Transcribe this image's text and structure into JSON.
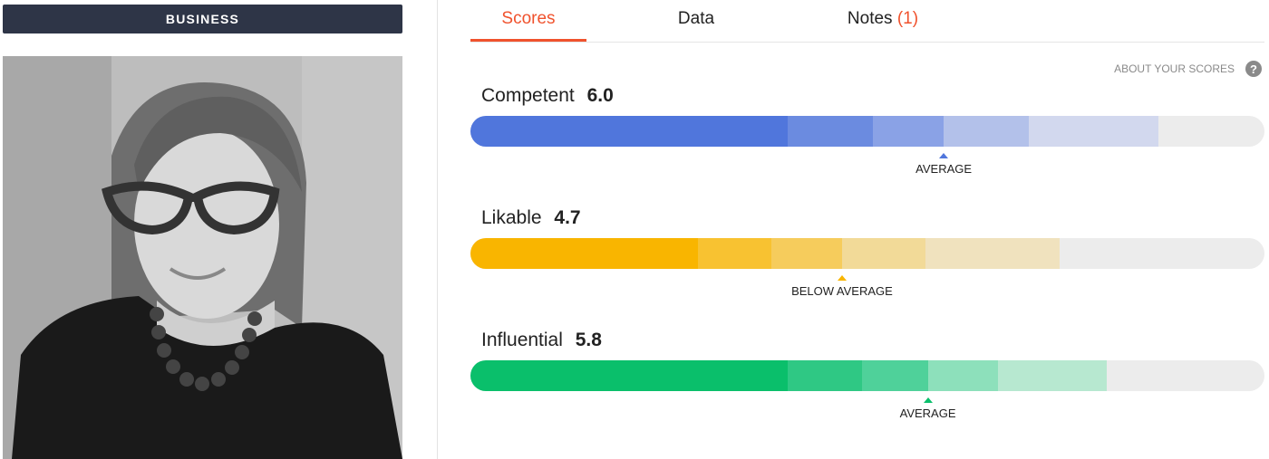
{
  "category": {
    "label": "BUSINESS"
  },
  "photo": {
    "alt": "Profile photo"
  },
  "tabs": [
    {
      "label": "Scores",
      "active": true
    },
    {
      "label": "Data",
      "active": false
    },
    {
      "label": "Notes",
      "count": "(1)",
      "active": false
    }
  ],
  "about": {
    "label": "ABOUT YOUR SCORES",
    "icon": "help-icon",
    "icon_glyph": "?"
  },
  "scores": [
    {
      "label": "Competent",
      "value": "6.0",
      "marker_label": "AVERAGE",
      "accent": "#5076dc",
      "segments": [
        "#5076dc",
        "#6b8be0",
        "#8aa2e6",
        "#b3c1ea",
        "#d2d8ee"
      ],
      "segment_bounds": [
        0.4,
        0.507,
        0.596,
        0.703,
        0.866
      ],
      "marker_position": 0.596
    },
    {
      "label": "Likable",
      "value": "4.7",
      "marker_label": "BELOW AVERAGE",
      "accent": "#f9b500",
      "segments": [
        "#f9b500",
        "#f8c231",
        "#f6cc5c",
        "#f2da98",
        "#f0e2be"
      ],
      "segment_bounds": [
        0.287,
        0.379,
        0.468,
        0.573,
        0.742
      ],
      "marker_position": 0.468
    },
    {
      "label": "Influential",
      "value": "5.8",
      "marker_label": "AVERAGE",
      "accent": "#0abf6b",
      "segments": [
        "#0abf6b",
        "#2fc884",
        "#4fd19a",
        "#8de0bb",
        "#b7e8d0"
      ],
      "segment_bounds": [
        0.4,
        0.493,
        0.576,
        0.664,
        0.801
      ],
      "marker_position": 0.576
    }
  ]
}
